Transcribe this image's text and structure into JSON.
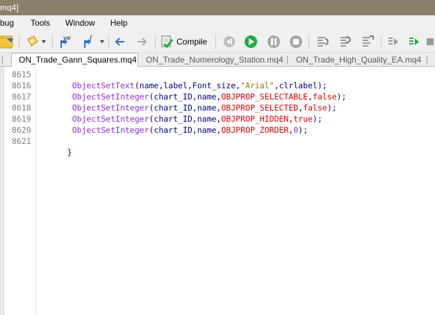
{
  "window": {
    "title_fragment": "mq4]"
  },
  "menu": {
    "items": [
      "bug",
      "Tools",
      "Window",
      "Help"
    ]
  },
  "toolbar": {
    "compile_label": "Compile",
    "var_label": "var",
    "f_label": "f",
    "colors": {
      "green": "#1cae3c",
      "gray": "#8c8c8c",
      "blue": "#2a6fd6"
    }
  },
  "tabs": [
    {
      "label": "ON_Trade_Gann_Squares.mq4",
      "active": true
    },
    {
      "label": "ON_Trade_Numerology_Station.mq4",
      "active": false
    },
    {
      "label": "ON_Trade_High_Quality_EA.mq4",
      "active": false
    }
  ],
  "editor": {
    "line_numbers": [
      "8615",
      "8616",
      "8617",
      "8618",
      "8619",
      "8620",
      "8621"
    ],
    "lines": [
      [
        {
          "t": "ObjectSetText",
          "c": "fn"
        },
        {
          "t": "(name,label,Font_size,",
          "c": "plain"
        },
        {
          "t": "\"Arial\"",
          "c": "str"
        },
        {
          "t": ",clrlabel);",
          "c": "plain"
        }
      ],
      [
        {
          "t": "ObjectSetInteger",
          "c": "fn"
        },
        {
          "t": "(chart_ID,name,",
          "c": "plain"
        },
        {
          "t": "OBJPROP_SELECTABLE",
          "c": "const"
        },
        {
          "t": ",",
          "c": "plain"
        },
        {
          "t": "false",
          "c": "const"
        },
        {
          "t": ");",
          "c": "plain"
        }
      ],
      [
        {
          "t": "ObjectSetInteger",
          "c": "fn"
        },
        {
          "t": "(chart_ID,name,",
          "c": "plain"
        },
        {
          "t": "OBJPROP_SELECTED",
          "c": "const"
        },
        {
          "t": ",",
          "c": "plain"
        },
        {
          "t": "false",
          "c": "const"
        },
        {
          "t": ");",
          "c": "plain"
        }
      ],
      [
        {
          "t": "ObjectSetInteger",
          "c": "fn"
        },
        {
          "t": "(chart_ID,name,",
          "c": "plain"
        },
        {
          "t": "OBJPROP_HIDDEN",
          "c": "const"
        },
        {
          "t": ",",
          "c": "plain"
        },
        {
          "t": "true",
          "c": "const"
        },
        {
          "t": ");",
          "c": "plain"
        }
      ],
      [
        {
          "t": "ObjectSetInteger",
          "c": "fn"
        },
        {
          "t": "(chart_ID,name,",
          "c": "plain"
        },
        {
          "t": "OBJPROP_ZORDER",
          "c": "const"
        },
        {
          "t": ",",
          "c": "plain"
        },
        {
          "t": "0",
          "c": "num"
        },
        {
          "t": ");",
          "c": "plain"
        }
      ],
      [],
      [
        {
          "t": "}",
          "c": "plain"
        }
      ]
    ]
  }
}
